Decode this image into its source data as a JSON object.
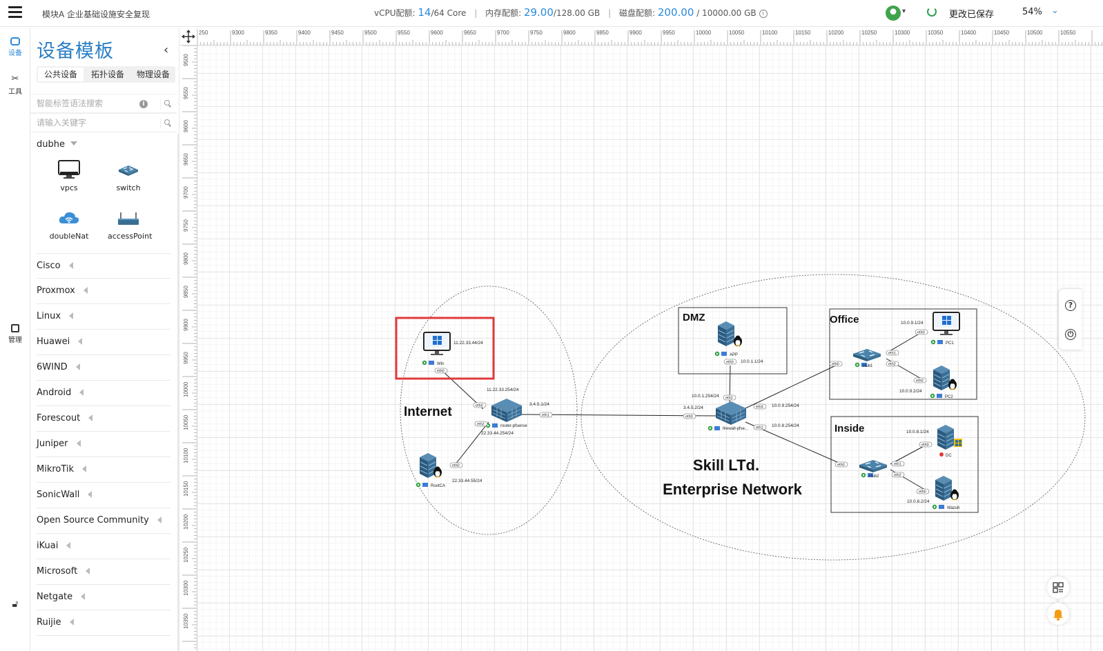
{
  "header": {
    "title": "模块A 企业基础设施安全复现",
    "vcpu_label": "vCPU配额:",
    "vcpu_used": "14",
    "vcpu_total": "/64 Core",
    "mem_label": "内存配额:",
    "mem_used": "29.00",
    "mem_total": "/128.00 GB",
    "disk_label": "磁盘配额:",
    "disk_used": "200.00",
    "disk_total": "/ 10000.00 GB",
    "save_status": "更改已保存",
    "zoom": "54%"
  },
  "rail": {
    "device": "设备",
    "tools": "工具",
    "manage": "管理"
  },
  "panel": {
    "title": "设备模板",
    "tabs": [
      "公共设备",
      "拓扑设备",
      "物理设备"
    ],
    "smart_search_placeholder": "智能标签语法搜索",
    "keyword_placeholder": "请输入关键字",
    "group": "dubhe",
    "devices": [
      "vpcs",
      "switch",
      "doubleNat",
      "accessPoint"
    ],
    "vendors": [
      "Cisco",
      "Proxmox",
      "Linux",
      "Huawei",
      "6WIND",
      "Android",
      "Forescout",
      "Juniper",
      "MikroTik",
      "SonicWall",
      "Open Source Community",
      "iKuai",
      "Microsoft",
      "Netgate",
      "Ruijie"
    ]
  },
  "ruler": {
    "x": [
      "250",
      "9300",
      "9350",
      "9400",
      "9450",
      "9500",
      "9550",
      "9600",
      "9650",
      "9700",
      "9750",
      "9800",
      "9850",
      "9900",
      "9950",
      "10000",
      "10050",
      "10100",
      "10150",
      "10200",
      "10250",
      "10300",
      "10350",
      "10400",
      "10450",
      "10500",
      "10550"
    ],
    "y": [
      "9500",
      "9550",
      "9600",
      "9650",
      "9700",
      "9750",
      "9800",
      "9850",
      "9900",
      "9950",
      "10000",
      "10050",
      "10100",
      "10150",
      "10200",
      "10250",
      "10300",
      "10350"
    ]
  },
  "topology": {
    "zone_internet": "Internet",
    "title_line1": "Skill LTd.",
    "title_line2": "Enterprise Network",
    "box_dmz": "DMZ",
    "box_office": "Office",
    "box_inside": "Inside",
    "nodes": {
      "win": "Win",
      "router": "router-pfsense",
      "rootca": "RootCA",
      "app": "APP",
      "firewall": "firewall-pfse...",
      "hub1": "Hub1",
      "hub2": "Hub2",
      "pc1": "PC1",
      "pc2": "PC2",
      "dc": "DC",
      "wazuh": "Wazuh"
    },
    "ips": {
      "win": "11.22.33.44/24",
      "router_top": "11.22.33.254/24",
      "router_right": "3.4.5.1/24",
      "router_bottom": "22.33.44.254/24",
      "rootca": "22.33.44.55/24",
      "app": "10.0.1.1/24",
      "fw_top": "10.0.1.254/24",
      "fw_left": "3.4.5.2/24",
      "fw_office": "10.0.9.254/24",
      "fw_inside": "10.0.8.254/24",
      "pc1": "10.0.9.1/24",
      "pc2": "10.0.9.2/24",
      "dc": "10.0.8.1/24",
      "wazuh": "10.0.8.2/24"
    },
    "ports": {
      "eth0": "eth0",
      "eth1": "eth1",
      "eth2": "eth2",
      "eth3": "eth3"
    }
  }
}
